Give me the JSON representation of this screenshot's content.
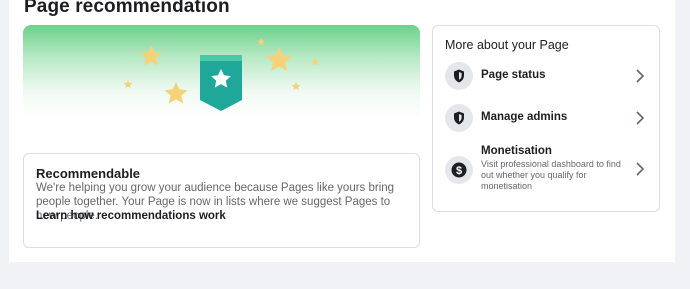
{
  "page": {
    "title": "Page recommendation"
  },
  "recommendation": {
    "title": "Recommendable",
    "body": "We're helping you grow your audience because Pages like yours bring people together. Your Page is now in lists where we suggest Pages to new people.",
    "link": "Learn how recommendations work"
  },
  "more": {
    "title": "More about your Page",
    "items": [
      {
        "label": "Page status",
        "icon": "shield-icon"
      },
      {
        "label": "Manage admins",
        "icon": "shield-icon"
      },
      {
        "label": "Monetisation",
        "icon": "dollar-icon",
        "sublabel": "Visit professional dashboard to find out whether you qualify for monetisation"
      }
    ]
  },
  "colors": {
    "accent_green": "#2fbf6b",
    "star_yellow": "#f5d27a",
    "badge_teal": "#1fa89a"
  }
}
